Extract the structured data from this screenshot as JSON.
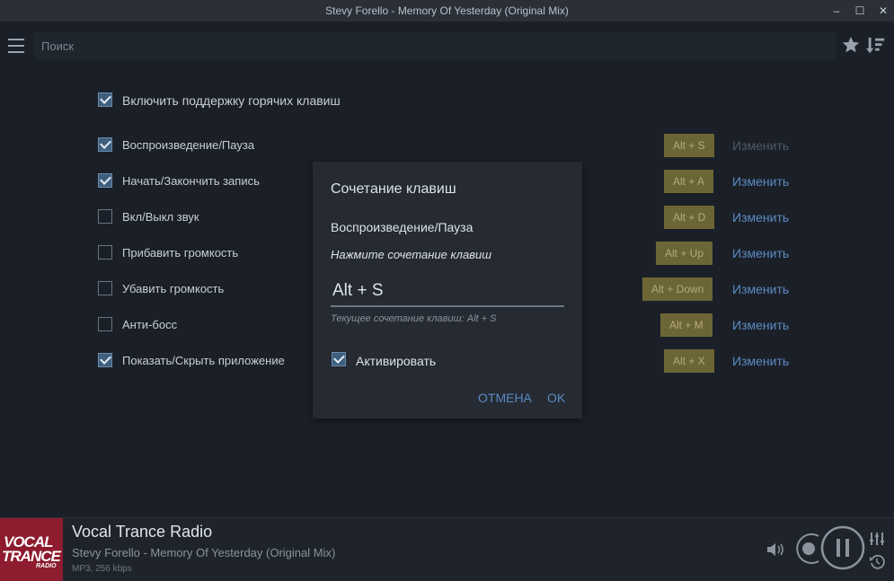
{
  "window": {
    "title": "Stevy Forello - Memory Of Yesterday (Original Mix)",
    "controls": [
      "minimize",
      "maximize",
      "close"
    ]
  },
  "toolbar": {
    "menu_icon": "hamburger-menu-icon",
    "search_placeholder": "Поиск",
    "favorites_icon": "star-icon",
    "sort_icon": "sort-filter-icon"
  },
  "hotkeys": {
    "enable_label": "Включить поддержку горячих клавиш",
    "enabled": true,
    "items": [
      {
        "label": "Воспроизведение/Пауза",
        "checked": true,
        "shortcut": "Alt + S",
        "action": "Изменить",
        "action_enabled": false
      },
      {
        "label": "Начать/Закончить запись",
        "checked": true,
        "shortcut": "Alt + A",
        "action": "Изменить",
        "action_enabled": true
      },
      {
        "label": "Вкл/Выкл звук",
        "checked": false,
        "shortcut": "Alt + D",
        "action": "Изменить",
        "action_enabled": true
      },
      {
        "label": "Прибавить громкость",
        "checked": false,
        "shortcut": "Alt + Up",
        "action": "Изменить",
        "action_enabled": true
      },
      {
        "label": "Убавить громкость",
        "checked": false,
        "shortcut": "Alt + Down",
        "action": "Изменить",
        "action_enabled": true
      },
      {
        "label": "Анти-босс",
        "checked": false,
        "shortcut": "Alt + M",
        "action": "Изменить",
        "action_enabled": true
      },
      {
        "label": "Показать/Скрыть приложение",
        "checked": true,
        "shortcut": "Alt + X",
        "action": "Изменить",
        "action_enabled": true
      }
    ]
  },
  "dialog": {
    "title": "Сочетание клавиш",
    "action_name": "Воспроизведение/Пауза",
    "prompt": "Нажмите сочетание клавиш",
    "input_value": "Alt + S",
    "current": "Текущее сочетание клавиш: Alt + S",
    "activate_label": "Активировать",
    "activate_checked": true,
    "cancel": "ОТМЕНА",
    "ok": "OK"
  },
  "player": {
    "logo_lines": [
      "VOCAL",
      "TRANCE",
      "RADIO"
    ],
    "station": "Vocal Trance Radio",
    "track": "Stevy Forello - Memory Of Yesterday (Original Mix)",
    "bitrate": "MP3, 256 kbps",
    "icons": [
      "volume-icon",
      "record-icon",
      "pause-icon",
      "equalizer-icon",
      "history-icon"
    ]
  },
  "colors": {
    "background": "#1b2028",
    "dialog": "#252a33",
    "accent_link": "#5c8ac2",
    "shortcut_badge": "#6c6636",
    "logo": "#8e1b2e"
  }
}
